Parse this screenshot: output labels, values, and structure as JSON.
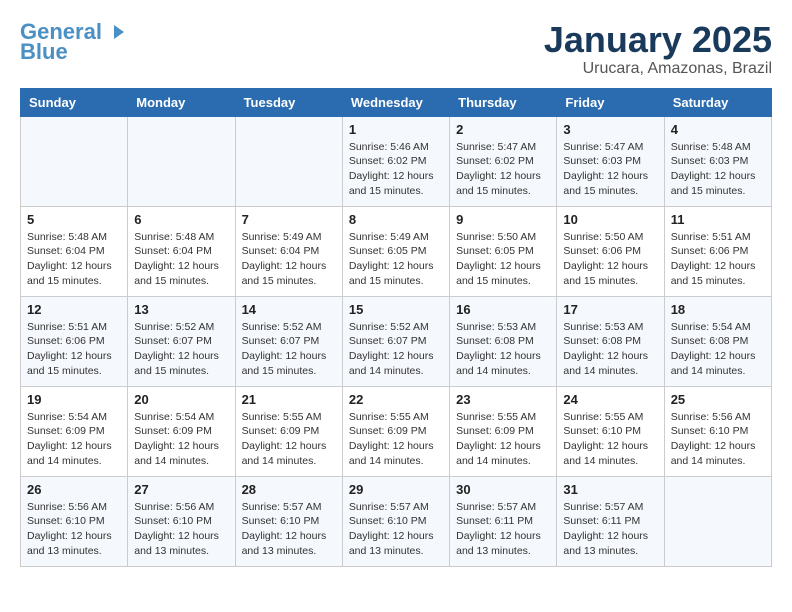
{
  "header": {
    "logo_line1": "General",
    "logo_line2": "Blue",
    "month_title": "January 2025",
    "location": "Urucara, Amazonas, Brazil"
  },
  "weekdays": [
    "Sunday",
    "Monday",
    "Tuesday",
    "Wednesday",
    "Thursday",
    "Friday",
    "Saturday"
  ],
  "weeks": [
    [
      {
        "day": "",
        "info": ""
      },
      {
        "day": "",
        "info": ""
      },
      {
        "day": "",
        "info": ""
      },
      {
        "day": "1",
        "info": "Sunrise: 5:46 AM\nSunset: 6:02 PM\nDaylight: 12 hours\nand 15 minutes."
      },
      {
        "day": "2",
        "info": "Sunrise: 5:47 AM\nSunset: 6:02 PM\nDaylight: 12 hours\nand 15 minutes."
      },
      {
        "day": "3",
        "info": "Sunrise: 5:47 AM\nSunset: 6:03 PM\nDaylight: 12 hours\nand 15 minutes."
      },
      {
        "day": "4",
        "info": "Sunrise: 5:48 AM\nSunset: 6:03 PM\nDaylight: 12 hours\nand 15 minutes."
      }
    ],
    [
      {
        "day": "5",
        "info": "Sunrise: 5:48 AM\nSunset: 6:04 PM\nDaylight: 12 hours\nand 15 minutes."
      },
      {
        "day": "6",
        "info": "Sunrise: 5:48 AM\nSunset: 6:04 PM\nDaylight: 12 hours\nand 15 minutes."
      },
      {
        "day": "7",
        "info": "Sunrise: 5:49 AM\nSunset: 6:04 PM\nDaylight: 12 hours\nand 15 minutes."
      },
      {
        "day": "8",
        "info": "Sunrise: 5:49 AM\nSunset: 6:05 PM\nDaylight: 12 hours\nand 15 minutes."
      },
      {
        "day": "9",
        "info": "Sunrise: 5:50 AM\nSunset: 6:05 PM\nDaylight: 12 hours\nand 15 minutes."
      },
      {
        "day": "10",
        "info": "Sunrise: 5:50 AM\nSunset: 6:06 PM\nDaylight: 12 hours\nand 15 minutes."
      },
      {
        "day": "11",
        "info": "Sunrise: 5:51 AM\nSunset: 6:06 PM\nDaylight: 12 hours\nand 15 minutes."
      }
    ],
    [
      {
        "day": "12",
        "info": "Sunrise: 5:51 AM\nSunset: 6:06 PM\nDaylight: 12 hours\nand 15 minutes."
      },
      {
        "day": "13",
        "info": "Sunrise: 5:52 AM\nSunset: 6:07 PM\nDaylight: 12 hours\nand 15 minutes."
      },
      {
        "day": "14",
        "info": "Sunrise: 5:52 AM\nSunset: 6:07 PM\nDaylight: 12 hours\nand 15 minutes."
      },
      {
        "day": "15",
        "info": "Sunrise: 5:52 AM\nSunset: 6:07 PM\nDaylight: 12 hours\nand 14 minutes."
      },
      {
        "day": "16",
        "info": "Sunrise: 5:53 AM\nSunset: 6:08 PM\nDaylight: 12 hours\nand 14 minutes."
      },
      {
        "day": "17",
        "info": "Sunrise: 5:53 AM\nSunset: 6:08 PM\nDaylight: 12 hours\nand 14 minutes."
      },
      {
        "day": "18",
        "info": "Sunrise: 5:54 AM\nSunset: 6:08 PM\nDaylight: 12 hours\nand 14 minutes."
      }
    ],
    [
      {
        "day": "19",
        "info": "Sunrise: 5:54 AM\nSunset: 6:09 PM\nDaylight: 12 hours\nand 14 minutes."
      },
      {
        "day": "20",
        "info": "Sunrise: 5:54 AM\nSunset: 6:09 PM\nDaylight: 12 hours\nand 14 minutes."
      },
      {
        "day": "21",
        "info": "Sunrise: 5:55 AM\nSunset: 6:09 PM\nDaylight: 12 hours\nand 14 minutes."
      },
      {
        "day": "22",
        "info": "Sunrise: 5:55 AM\nSunset: 6:09 PM\nDaylight: 12 hours\nand 14 minutes."
      },
      {
        "day": "23",
        "info": "Sunrise: 5:55 AM\nSunset: 6:09 PM\nDaylight: 12 hours\nand 14 minutes."
      },
      {
        "day": "24",
        "info": "Sunrise: 5:55 AM\nSunset: 6:10 PM\nDaylight: 12 hours\nand 14 minutes."
      },
      {
        "day": "25",
        "info": "Sunrise: 5:56 AM\nSunset: 6:10 PM\nDaylight: 12 hours\nand 14 minutes."
      }
    ],
    [
      {
        "day": "26",
        "info": "Sunrise: 5:56 AM\nSunset: 6:10 PM\nDaylight: 12 hours\nand 13 minutes."
      },
      {
        "day": "27",
        "info": "Sunrise: 5:56 AM\nSunset: 6:10 PM\nDaylight: 12 hours\nand 13 minutes."
      },
      {
        "day": "28",
        "info": "Sunrise: 5:57 AM\nSunset: 6:10 PM\nDaylight: 12 hours\nand 13 minutes."
      },
      {
        "day": "29",
        "info": "Sunrise: 5:57 AM\nSunset: 6:10 PM\nDaylight: 12 hours\nand 13 minutes."
      },
      {
        "day": "30",
        "info": "Sunrise: 5:57 AM\nSunset: 6:11 PM\nDaylight: 12 hours\nand 13 minutes."
      },
      {
        "day": "31",
        "info": "Sunrise: 5:57 AM\nSunset: 6:11 PM\nDaylight: 12 hours\nand 13 minutes."
      },
      {
        "day": "",
        "info": ""
      }
    ]
  ]
}
